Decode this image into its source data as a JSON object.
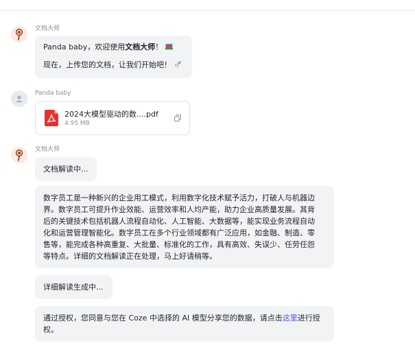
{
  "messages": [
    {
      "sender": "文档大师",
      "welcome_prefix": "Panda baby，欢迎使用",
      "welcome_bold": "文档大师",
      "welcome_suffix": "！",
      "welcome_icon": "books-emoji",
      "upload_prompt": "现在，上传您的文档，让我们开始吧！",
      "upload_icon": "rocket-emoji"
    },
    {
      "sender": "Panda baby",
      "file": {
        "name": "2024大模型驱动的数....pdf",
        "size": "4.95 MB",
        "icon": "pdf-icon"
      }
    },
    {
      "sender": "文档大师",
      "status": "文档解读中...",
      "summary_lines": [
        "数字员工是一种新兴的企业用工模式，利用数字化技术赋予活力，打破人与机器边",
        "界。数字员工可提升作业效能、运营效率和人均产能，助力企业高质量发展。其背",
        "后的关键技术包括机器人流程自动化、人工智能、大数据等，能实现业务流程自动",
        "化和运营管理智能化。数字员工在多个行业领域都有广泛应用，如金融、制造、零",
        "售等，能完成各种高重复、大批量、标准化的工作，具有高效、失误少、任劳任怨",
        "等特点。详细的文档解读正在处理，马上好请稍等。"
      ],
      "detail_status": "详细解读生成中...",
      "consent_prefix": "通过授权，您同意与您在 Coze 中选择的 AI 模型分享您的数据，请点击",
      "consent_link": "这里",
      "consent_suffix_1": "进行授",
      "consent_suffix_2": "权。"
    }
  ],
  "colors": {
    "bubble_bg": "#f2f3f5",
    "link": "#4d53e8",
    "pdf_red": "#e5322d",
    "sender_gray": "#8b9098"
  }
}
